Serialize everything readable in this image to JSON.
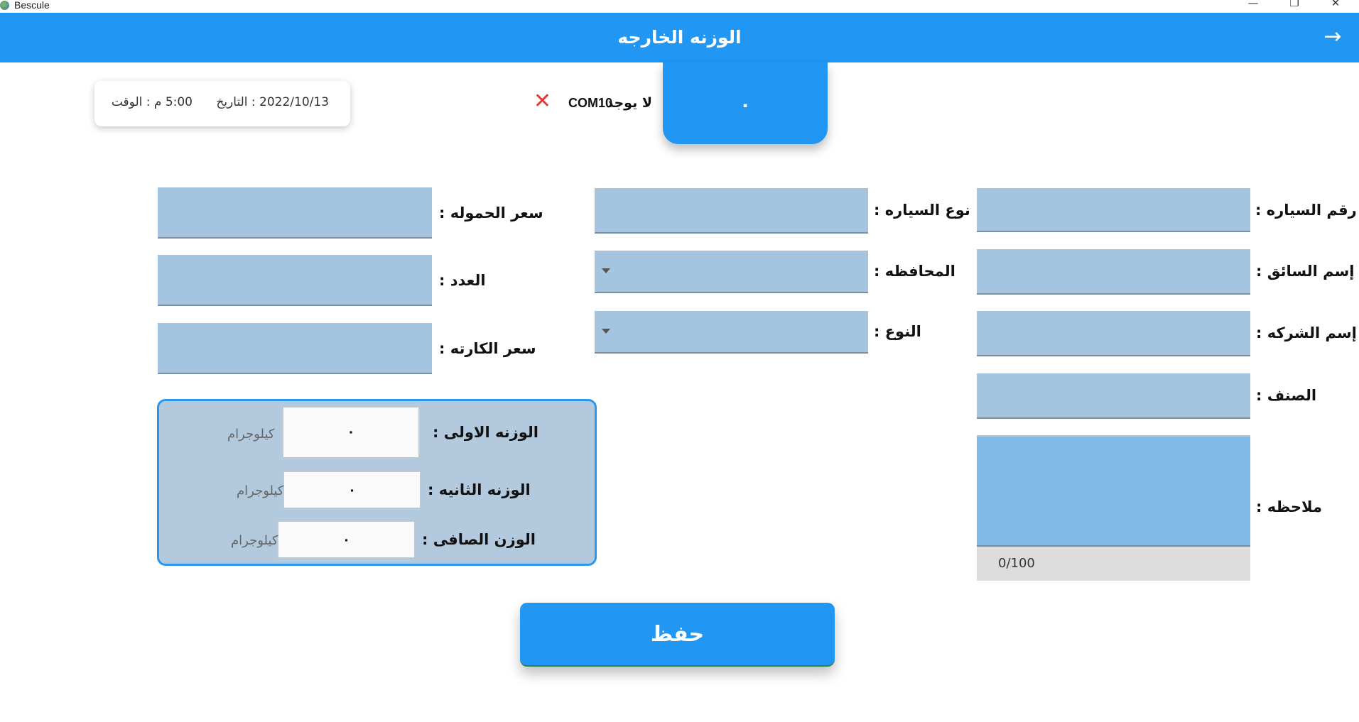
{
  "window": {
    "app_name": "Bescule",
    "minimize": "—",
    "maximize": "❐",
    "close": "✕"
  },
  "appbar": {
    "title": "الوزنه الخارجه",
    "back_icon": "→"
  },
  "weight_display": {
    "value": "٠"
  },
  "connection": {
    "status": "لا يوجد",
    "port": "COM10",
    "icon": "✕"
  },
  "datetime": {
    "date": "2022/10/13 : التاريخ",
    "time": "5:00 م : الوقت"
  },
  "form": {
    "car_number_label": "رقم السياره :",
    "driver_name_label": "إسم السائق :",
    "company_name_label": "إسم الشركه :",
    "item_label": "الصنف :",
    "notes_label": "ملاحظه :",
    "notes_counter": "0/100",
    "car_type_label": "نوع السياره :",
    "governorate_label": "المحافظه :",
    "kind_label": "النوع :",
    "load_price_label": "سعر الحموله :",
    "count_label": "العدد :",
    "card_price_label": "سعر الكارته :"
  },
  "weights": {
    "first_label": "الوزنه الاولى :",
    "first_value": "٠",
    "second_label": "الوزنه الثانيه :",
    "second_value": "٠",
    "net_label": "الوزن الصافى :",
    "net_value": "٠",
    "unit": "كيلوجرام"
  },
  "actions": {
    "save_label": "حفظ"
  },
  "colors": {
    "primary": "#2196f3",
    "field": "#a4c4e0",
    "weights_panel": "#b3cade",
    "error": "#e53935"
  }
}
